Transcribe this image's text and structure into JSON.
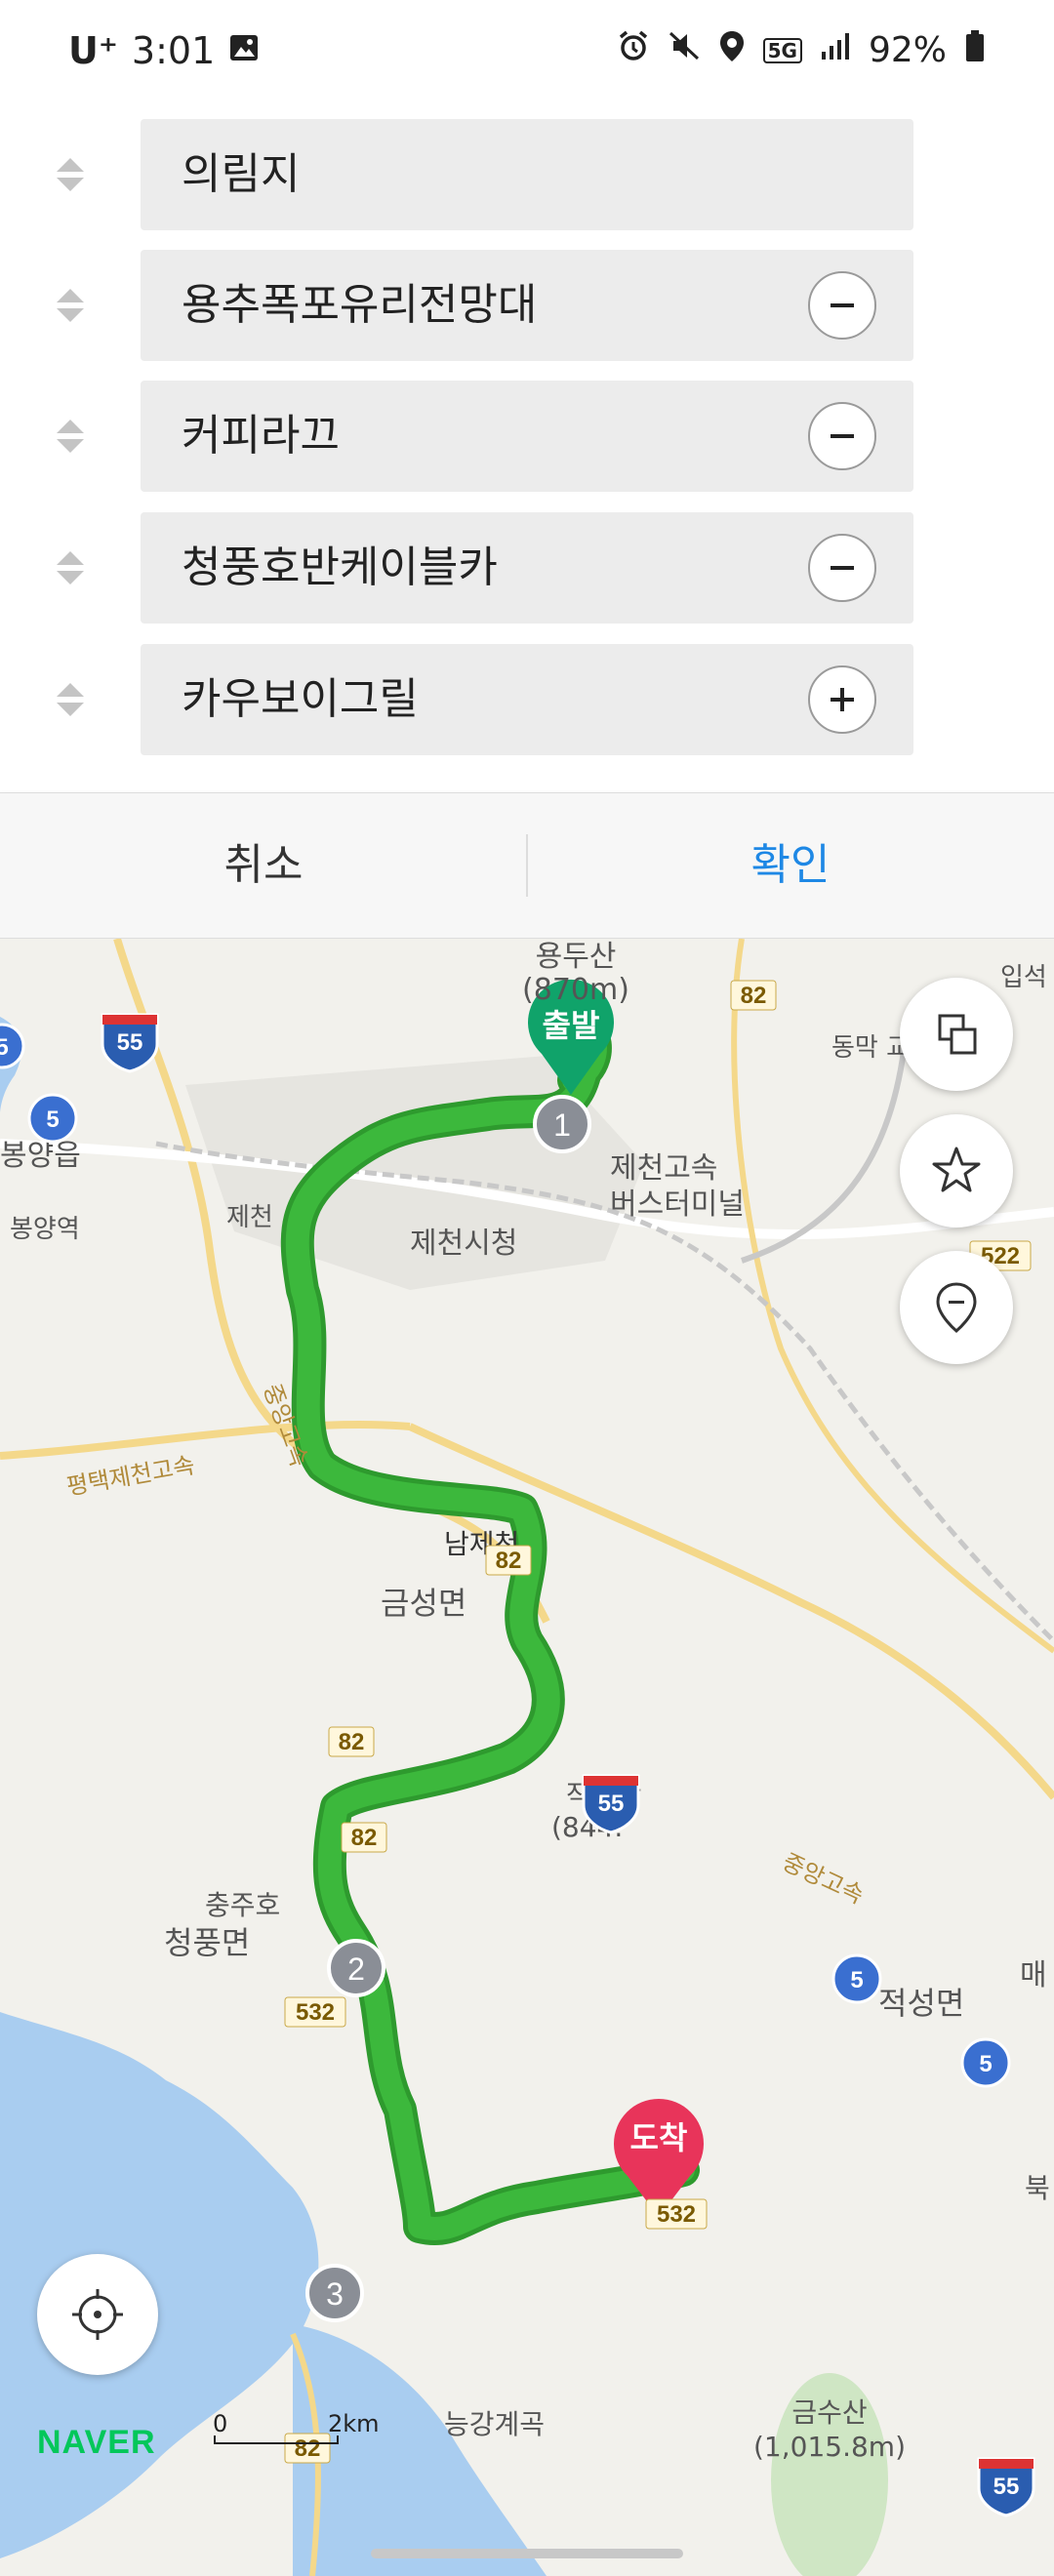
{
  "status": {
    "carrier": "U⁺",
    "time": "3:01",
    "network": "5G",
    "battery": "92%"
  },
  "waypoints": [
    {
      "label": "의림지",
      "action": "none"
    },
    {
      "label": "용추폭포유리전망대",
      "action": "remove"
    },
    {
      "label": "커피라끄",
      "action": "remove"
    },
    {
      "label": "청풍호반케이블카",
      "action": "remove"
    },
    {
      "label": "카우보이그릴",
      "action": "add"
    }
  ],
  "actions": {
    "cancel": "취소",
    "confirm": "확인"
  },
  "map": {
    "labels": {
      "yongdusan": "용두산",
      "yongdusan_h": "(870m)",
      "bongyang_eup": "봉양읍",
      "bongyang_station": "봉양역",
      "jecheon_ic": "제천",
      "bus_terminal_1": "제천고속",
      "bus_terminal_2": "버스터미널",
      "city_hall": "제천시청",
      "dongmak": "동막 교차로",
      "ipseok": "입석",
      "jungang_exp": "중앙고속",
      "pyeongtaek_exp": "평택제천고속",
      "namjecheon": "남제천",
      "geumseong": "금성면",
      "jakseongsan": "작성산",
      "jakseongsan_h": "(844.",
      "chungjuho": "충주호",
      "cheongpung": "청풍면",
      "jeokseong": "적성면",
      "neunggang": "능강계곡",
      "geumsusan": "금수산",
      "geumsusan_h": "(1,015.8m)",
      "jungang_exp2": "중앙고속",
      "mae": "매",
      "buk": "북"
    },
    "start_label": "출발",
    "end_label": "도착",
    "stops": [
      "1",
      "2",
      "3"
    ],
    "road_shields": {
      "r82a": "82",
      "r82b": "82",
      "r82c": "82",
      "r82d": "82",
      "r82e": "82",
      "r532a": "532",
      "r532b": "532",
      "r522": "522",
      "e55a": "55",
      "e55b": "55",
      "e55c": "55",
      "n5a": "5",
      "n5b": "5",
      "n5c": "5",
      "n5d": "5"
    },
    "scale": {
      "zero": "0",
      "dist": "2km"
    },
    "brand": "NAVER"
  },
  "colors": {
    "route": "#3cb83c",
    "accent": "#1e88e5",
    "start": "#10a36a",
    "end": "#e8345a",
    "naver": "#03c75a"
  },
  "icons": [
    "drag-handle-icon",
    "minus-icon",
    "plus-icon",
    "layers-icon",
    "star-icon",
    "location-pin-icon",
    "gps-target-icon"
  ]
}
